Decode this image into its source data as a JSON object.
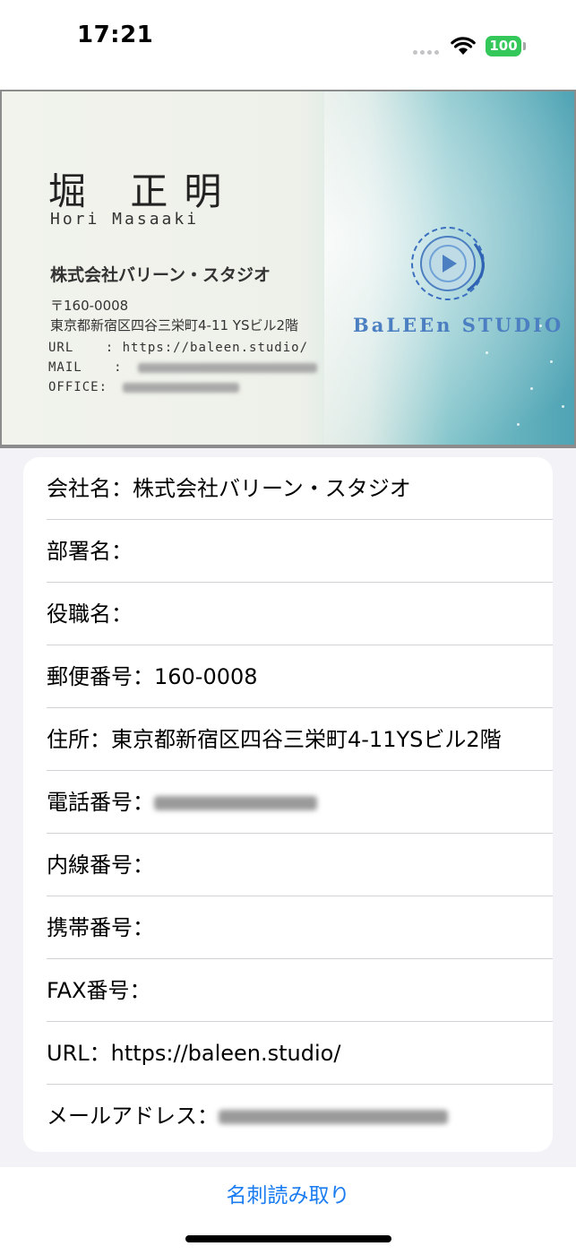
{
  "status_bar": {
    "time": "17:21",
    "battery": "100"
  },
  "card": {
    "name_jp": "堀 正明",
    "name_en": "Hori Masaaki",
    "company": "株式会社バリーン・スタジオ",
    "zip": "〒160-0008",
    "address": "東京都新宿区四谷三栄町4-11 YSビル2階",
    "url_label": "URL",
    "url_value": ": https://baleen.studio/",
    "mail_label": "MAIL",
    "office_label": "OFFICE:",
    "brand": "BaLEEn STUDIO"
  },
  "fields": [
    {
      "label": "会社名：",
      "value": "株式会社バリーン・スタジオ"
    },
    {
      "label": "部署名：",
      "value": ""
    },
    {
      "label": "役職名：",
      "value": ""
    },
    {
      "label": "郵便番号：",
      "value": "160-0008"
    },
    {
      "label": "住所：",
      "value": "東京都新宿区四谷三栄町4-11YSビル2階"
    },
    {
      "label": "電話番号：",
      "value": ""
    },
    {
      "label": "内線番号：",
      "value": ""
    },
    {
      "label": "携帯番号：",
      "value": ""
    },
    {
      "label": "FAX番号：",
      "value": ""
    },
    {
      "label": "URL：",
      "value": "https://baleen.studio/"
    },
    {
      "label": "メールアドレス：",
      "value": ""
    }
  ],
  "actions": {
    "scan_button": "名刺読み取り"
  },
  "colors": {
    "accent": "#1a7cf0",
    "battery": "#34c759",
    "background": "#f2f2f7"
  }
}
